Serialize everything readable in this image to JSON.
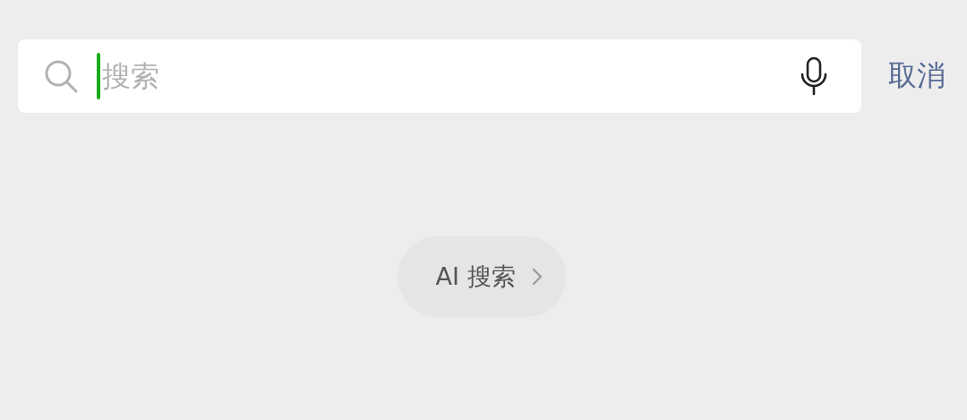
{
  "search": {
    "placeholder": "搜索",
    "focused": true
  },
  "cancel": "取消",
  "ai_search": {
    "label": "AI 搜索"
  }
}
